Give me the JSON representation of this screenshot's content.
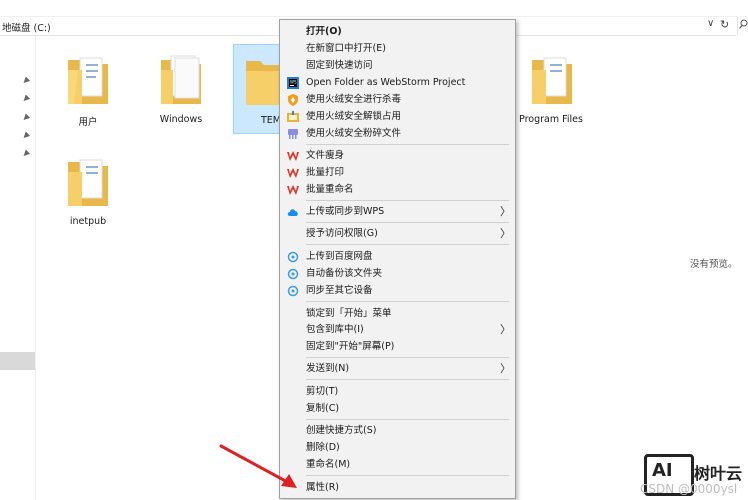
{
  "address_bar": {
    "path": "地磁盘 (C:)",
    "chevron": "∨",
    "refresh": "↻"
  },
  "folders": [
    {
      "name": "用户"
    },
    {
      "name": "Windows"
    },
    {
      "name": "TEM"
    },
    {
      "name": "Program Files"
    },
    {
      "name": "inetpub"
    }
  ],
  "preview_text": "没有预览。",
  "context_menu": {
    "items": [
      {
        "label": "打开(O)",
        "bold": true
      },
      {
        "label": "在新窗口中打开(E)"
      },
      {
        "label": "固定到快速访问"
      },
      {
        "label": "Open Folder as WebStorm Project",
        "icon": "webstorm-icon"
      },
      {
        "label": "使用火绒安全进行杀毒",
        "icon": "huorong-shield-icon"
      },
      {
        "label": "使用火绒安全解锁占用",
        "icon": "huorong-unlock-icon"
      },
      {
        "label": "使用火绒安全粉碎文件",
        "icon": "huorong-shred-icon"
      },
      {
        "label": "文件瘦身",
        "icon": "wps-icon"
      },
      {
        "label": "批量打印",
        "icon": "wps-icon"
      },
      {
        "label": "批量重命名",
        "icon": "wps-icon"
      },
      {
        "label": "上传或同步到WPS",
        "icon": "wps-cloud-icon",
        "submenu": true
      },
      {
        "label": "授予访问权限(G)",
        "submenu": true
      },
      {
        "label": "上传到百度网盘",
        "icon": "baidu-netdisk-icon"
      },
      {
        "label": "自动备份该文件夹",
        "icon": "baidu-netdisk-icon"
      },
      {
        "label": "同步至其它设备",
        "icon": "baidu-netdisk-icon"
      },
      {
        "label": "锁定到「开始」菜单"
      },
      {
        "label": "包含到库中(I)",
        "submenu": true
      },
      {
        "label": "固定到\"开始\"屏幕(P)"
      },
      {
        "label": "发送到(N)",
        "submenu": true
      },
      {
        "label": "剪切(T)"
      },
      {
        "label": "复制(C)"
      },
      {
        "label": "创建快捷方式(S)"
      },
      {
        "label": "删除(D)"
      },
      {
        "label": "重命名(M)"
      },
      {
        "label": "属性(R)"
      }
    ],
    "submenu_arrow": "〉"
  },
  "watermark": {
    "logo_text": "AI",
    "brand": "树叶云",
    "credit": "CSDN @0000ysl"
  },
  "colors": {
    "folder": "#f5c85c",
    "selection": "#cce8ff",
    "menu_bg": "#f2f2f2",
    "wps_red": "#d7372b",
    "arrow_red": "#e02020"
  }
}
